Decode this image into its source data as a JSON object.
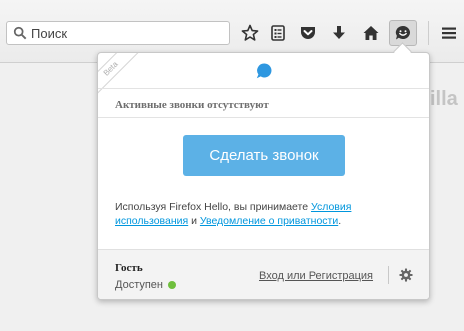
{
  "toolbar": {
    "search_placeholder": "Поиск",
    "icons": [
      "search-icon",
      "star-icon",
      "reading-list-icon",
      "pocket-icon",
      "download-icon",
      "home-icon",
      "hello-icon",
      "menu-icon"
    ]
  },
  "background": {
    "partial_text": "illa"
  },
  "panel": {
    "beta_label": "Beta",
    "no_calls_text": "Активные звонки отсутствуют",
    "call_button_label": "Сделать звонок",
    "terms": {
      "prefix": "Используя Firefox Hello, вы принимаете ",
      "terms_link": "Условия использования",
      "middle": " и ",
      "privacy_link": "Уведомление о приватности",
      "suffix": "."
    },
    "footer": {
      "user_name": "Гость",
      "status_text": "Доступен",
      "login_label": "Вход или Регистрация"
    }
  },
  "colors": {
    "accent": "#5cb1e6",
    "status_available": "#6fbf3d",
    "link": "#0096dd"
  }
}
